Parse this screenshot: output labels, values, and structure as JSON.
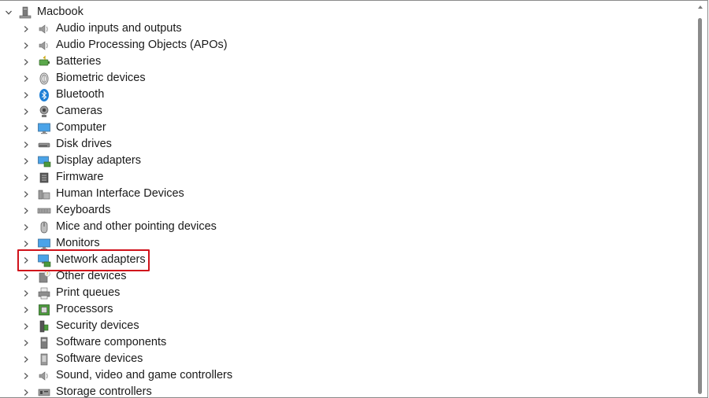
{
  "root": {
    "label": "Macbook",
    "icon": "computer-tower-icon"
  },
  "items": [
    {
      "label": "Audio inputs and outputs",
      "icon": "speaker-icon"
    },
    {
      "label": "Audio Processing Objects (APOs)",
      "icon": "speaker-icon"
    },
    {
      "label": "Batteries",
      "icon": "battery-icon"
    },
    {
      "label": "Biometric devices",
      "icon": "fingerprint-icon"
    },
    {
      "label": "Bluetooth",
      "icon": "bluetooth-icon"
    },
    {
      "label": "Cameras",
      "icon": "camera-icon"
    },
    {
      "label": "Computer",
      "icon": "monitor-icon"
    },
    {
      "label": "Disk drives",
      "icon": "disk-drive-icon"
    },
    {
      "label": "Display adapters",
      "icon": "display-adapter-icon"
    },
    {
      "label": "Firmware",
      "icon": "chip-icon"
    },
    {
      "label": "Human Interface Devices",
      "icon": "hid-icon"
    },
    {
      "label": "Keyboards",
      "icon": "keyboard-icon"
    },
    {
      "label": "Mice and other pointing devices",
      "icon": "mouse-icon"
    },
    {
      "label": "Monitors",
      "icon": "monitor-icon"
    },
    {
      "label": "Network adapters",
      "icon": "network-icon"
    },
    {
      "label": "Other devices",
      "icon": "unknown-device-icon"
    },
    {
      "label": "Print queues",
      "icon": "printer-icon"
    },
    {
      "label": "Processors",
      "icon": "processor-icon"
    },
    {
      "label": "Security devices",
      "icon": "security-device-icon"
    },
    {
      "label": "Software components",
      "icon": "software-component-icon"
    },
    {
      "label": "Software devices",
      "icon": "software-device-icon"
    },
    {
      "label": "Sound, video and game controllers",
      "icon": "speaker-icon"
    },
    {
      "label": "Storage controllers",
      "icon": "storage-controller-icon"
    }
  ],
  "highlight_color": "#d0121b",
  "accent_blue": "#1e7fd6"
}
